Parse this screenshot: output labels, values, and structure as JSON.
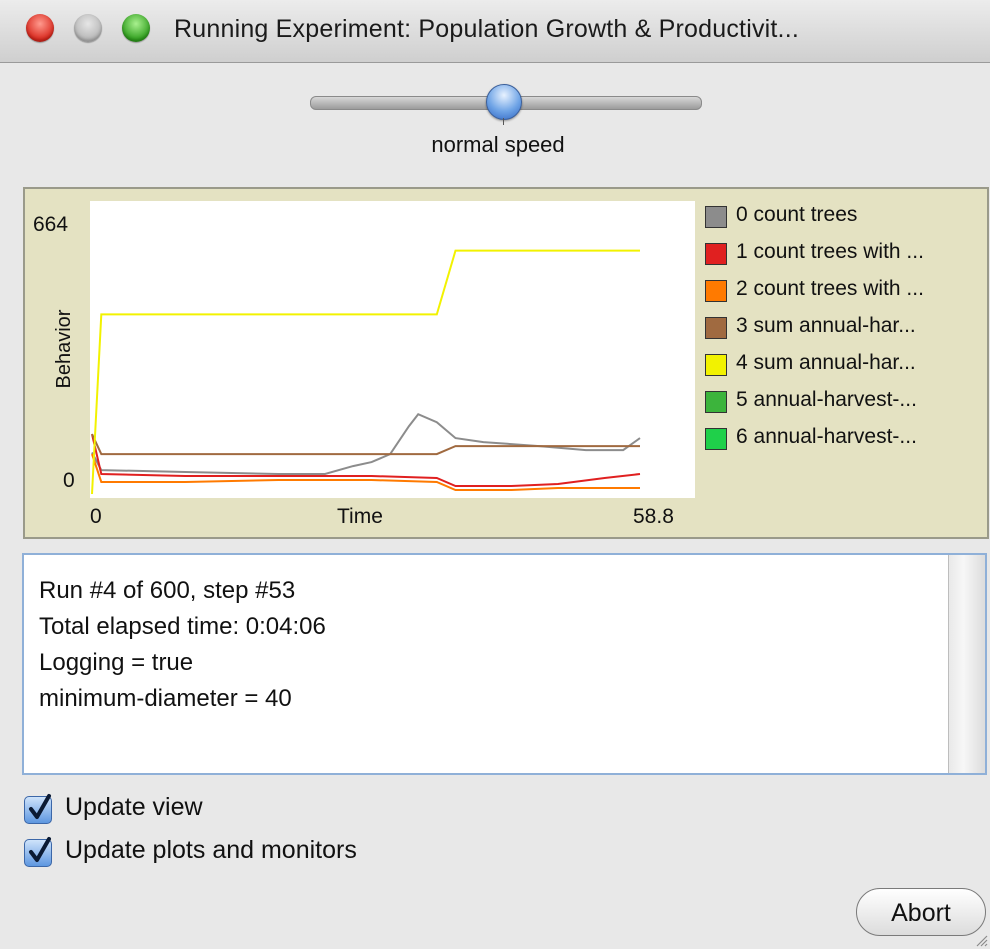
{
  "window": {
    "title": "Running Experiment: Population Growth & Productivit..."
  },
  "speed": {
    "label": "normal speed",
    "position": 0.5
  },
  "log": {
    "lines": [
      "Run #4 of 600, step #53",
      "Total elapsed time: 0:04:06",
      "Logging = true",
      "minimum-diameter = 40"
    ]
  },
  "options": {
    "update_view": {
      "label": "Update view",
      "checked": true
    },
    "update_plots": {
      "label": "Update plots and monitors",
      "checked": true
    }
  },
  "buttons": {
    "abort": "Abort"
  },
  "chart_data": {
    "type": "line",
    "xlabel": "Time",
    "ylabel": "Behavior",
    "x_tick_labels": [
      "0",
      "58.8"
    ],
    "y_tick_labels": [
      "0",
      "664"
    ],
    "xlim": [
      0,
      58.8
    ],
    "ylim": [
      0,
      664
    ],
    "legend_position": "right",
    "series": [
      {
        "name": "0 count trees",
        "color": "#8c8c8c",
        "points": [
          [
            0,
            104
          ],
          [
            1,
            60
          ],
          [
            10,
            55
          ],
          [
            20,
            50
          ],
          [
            25,
            50
          ],
          [
            28,
            70
          ],
          [
            30,
            80
          ],
          [
            32,
            100
          ],
          [
            34,
            170
          ],
          [
            35,
            200
          ],
          [
            37,
            180
          ],
          [
            39,
            140
          ],
          [
            42,
            130
          ],
          [
            48,
            120
          ],
          [
            53,
            110
          ],
          [
            57,
            110
          ],
          [
            58.8,
            140
          ]
        ]
      },
      {
        "name": "1 count trees with ...",
        "color": "#e02020",
        "points": [
          [
            0,
            150
          ],
          [
            1,
            50
          ],
          [
            10,
            45
          ],
          [
            20,
            45
          ],
          [
            30,
            45
          ],
          [
            37,
            40
          ],
          [
            39,
            20
          ],
          [
            45,
            20
          ],
          [
            50,
            25
          ],
          [
            55,
            40
          ],
          [
            58.8,
            50
          ]
        ]
      },
      {
        "name": "2 count trees with ...",
        "color": "#ff7a00",
        "points": [
          [
            0,
            100
          ],
          [
            1,
            30
          ],
          [
            10,
            30
          ],
          [
            20,
            35
          ],
          [
            30,
            35
          ],
          [
            37,
            30
          ],
          [
            39,
            10
          ],
          [
            45,
            10
          ],
          [
            50,
            15
          ],
          [
            55,
            15
          ],
          [
            58.8,
            15
          ]
        ]
      },
      {
        "name": "3 sum annual-har...",
        "color": "#a06a40",
        "points": [
          [
            0,
            150
          ],
          [
            1,
            100
          ],
          [
            10,
            100
          ],
          [
            20,
            100
          ],
          [
            30,
            100
          ],
          [
            37,
            100
          ],
          [
            39,
            120
          ],
          [
            45,
            120
          ],
          [
            50,
            120
          ],
          [
            58.8,
            120
          ]
        ]
      },
      {
        "name": "4 sum annual-har...",
        "color": "#f2f200",
        "points": [
          [
            0,
            0
          ],
          [
            1,
            450
          ],
          [
            10,
            450
          ],
          [
            20,
            450
          ],
          [
            30,
            450
          ],
          [
            37,
            450
          ],
          [
            39,
            610
          ],
          [
            45,
            610
          ],
          [
            50,
            610
          ],
          [
            58.8,
            610
          ]
        ]
      },
      {
        "name": "5 annual-harvest-...",
        "color": "#3cb43c",
        "points": []
      },
      {
        "name": "6 annual-harvest-...",
        "color": "#1fd04a",
        "points": []
      }
    ]
  }
}
